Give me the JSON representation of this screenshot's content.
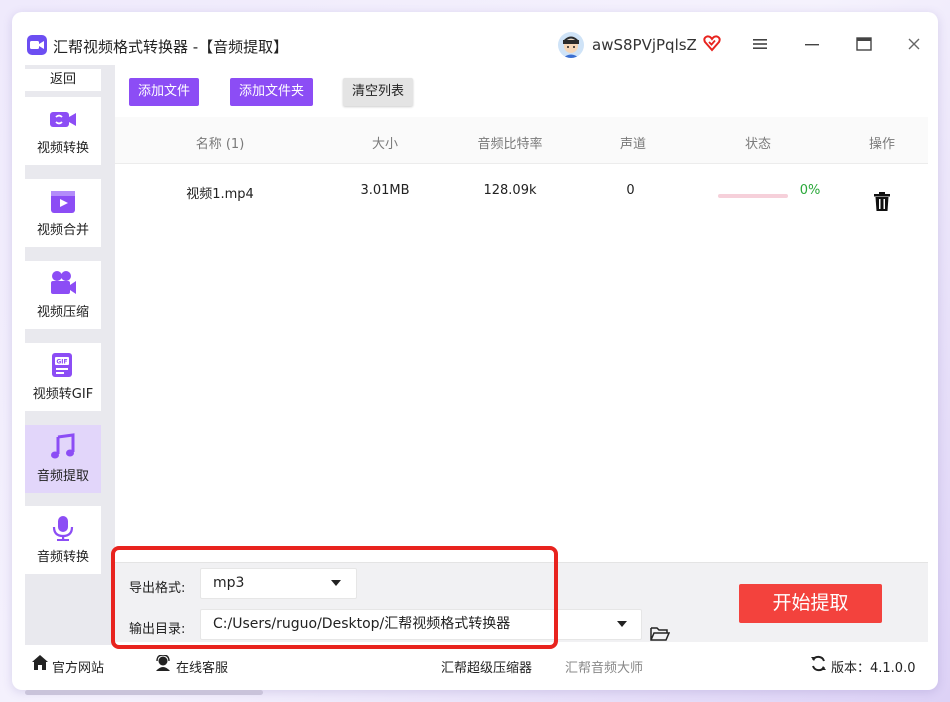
{
  "window": {
    "app_title": "汇帮视频格式转换器  -【音频提取】",
    "username": "awS8PVjPqlsZ"
  },
  "sidebar": {
    "back_label": "返回",
    "items": [
      {
        "label": "视频转换",
        "icon": "video-convert-icon"
      },
      {
        "label": "视频合并",
        "icon": "video-merge-icon"
      },
      {
        "label": "视频压缩",
        "icon": "video-compress-icon"
      },
      {
        "label": "视频转GIF",
        "icon": "gif-icon"
      },
      {
        "label": "音频提取",
        "icon": "music-note-icon",
        "active": true
      },
      {
        "label": "音频转换",
        "icon": "microphone-icon"
      }
    ]
  },
  "toolbar": {
    "add_file": "添加文件",
    "add_folder": "添加文件夹",
    "clear_list": "清空列表"
  },
  "table": {
    "headers": [
      "名称 (1)",
      "大小",
      "音频比特率",
      "声道",
      "状态",
      "操作"
    ],
    "rows": [
      {
        "name": "视频1.mp4",
        "size": "3.01MB",
        "bitrate": "128.09k",
        "channels": "0",
        "progress": 0,
        "progress_text": "0%"
      }
    ]
  },
  "settings": {
    "format_label": "导出格式:",
    "format_value": "mp3",
    "output_label": "输出目录:",
    "output_value": "C:/Users/ruguo/Desktop/汇帮视频格式转换器",
    "start_label": "开始提取"
  },
  "statusbar": {
    "website": "官方网站",
    "support": "在线客服",
    "link1": "汇帮超级压缩器",
    "link2": "汇帮音频大师",
    "version": "版本：4.1.0.0"
  },
  "colors": {
    "accent": "#8c4df5",
    "start_button": "#f3423d",
    "highlight": "#e8231e",
    "progress_text": "#2aa83a"
  }
}
